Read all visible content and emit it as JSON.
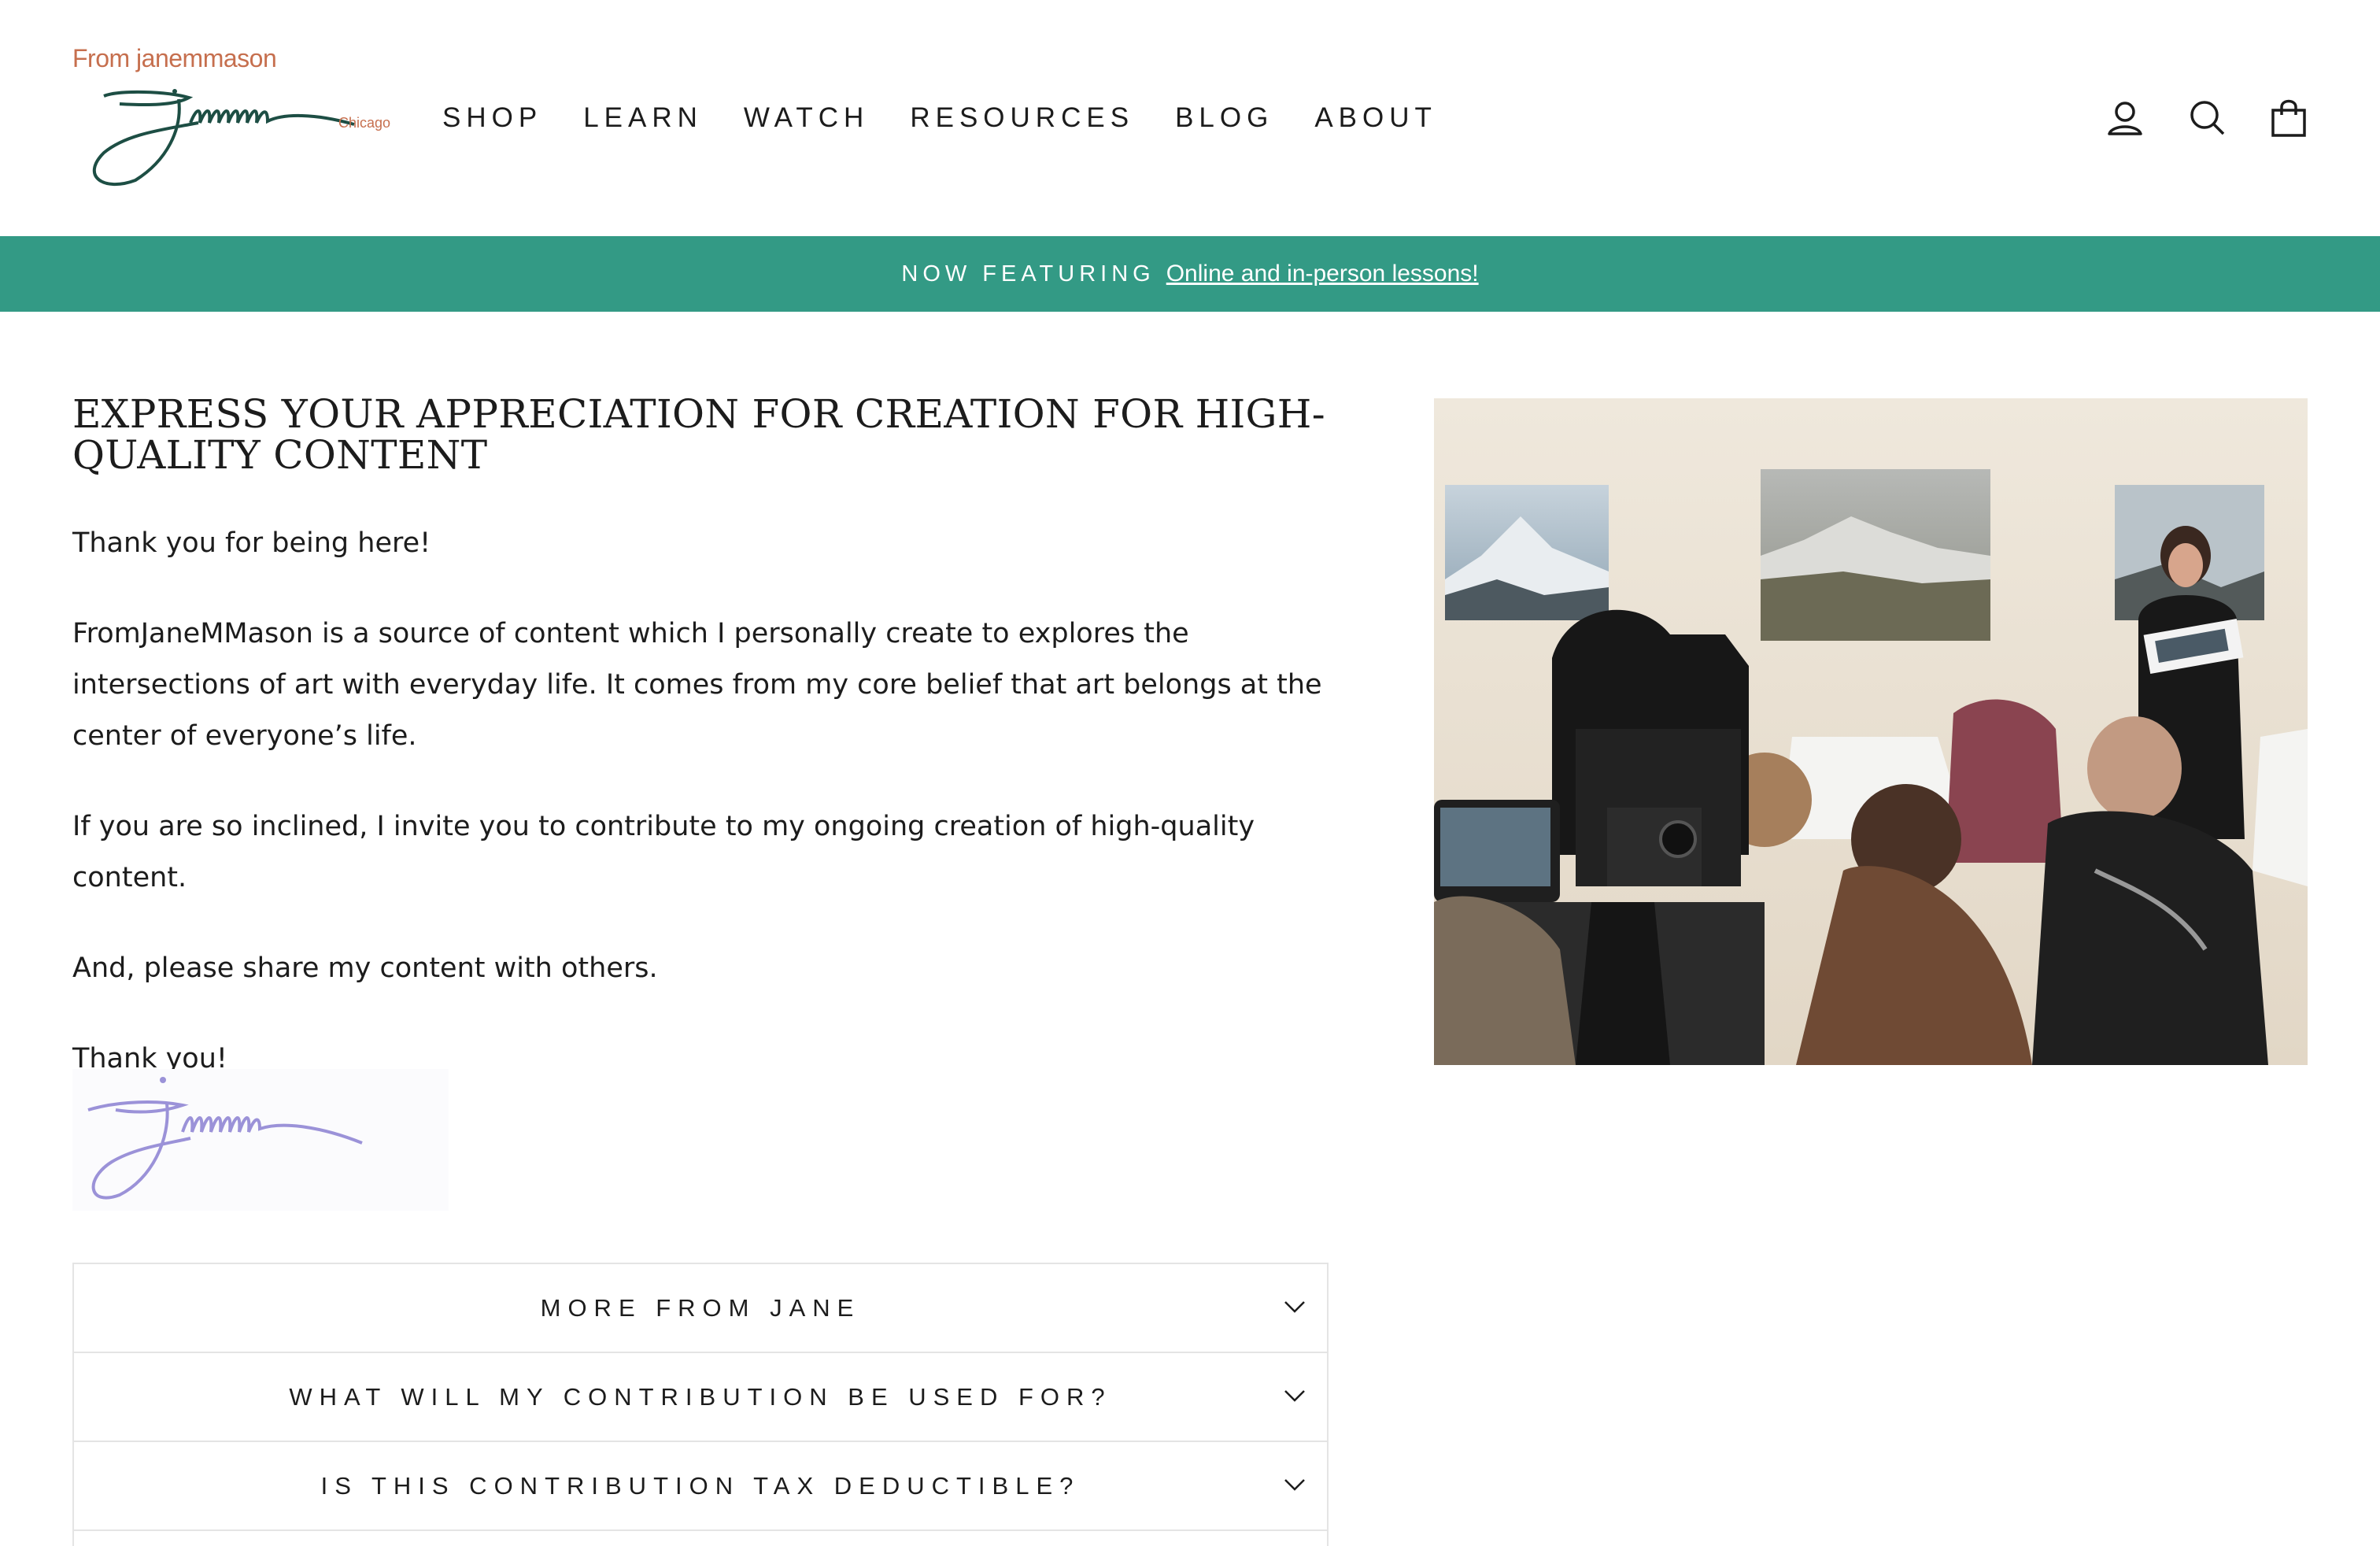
{
  "logo": {
    "brand_text": "From janemmason",
    "city_text": "Chicago",
    "signature_color": "#1d4e44",
    "text_color": "#c66f4e"
  },
  "nav": {
    "items": [
      {
        "label": "SHOP"
      },
      {
        "label": "LEARN"
      },
      {
        "label": "WATCH"
      },
      {
        "label": "RESOURCES"
      },
      {
        "label": "BLOG"
      },
      {
        "label": "ABOUT"
      }
    ]
  },
  "header_icons": [
    "account-icon",
    "search-icon",
    "cart-icon"
  ],
  "banner": {
    "label": "NOW FEATURING",
    "link_text": "Online and in-person lessons!",
    "color": "#339a85"
  },
  "main": {
    "heading": "EXPRESS YOUR APPRECIATION FOR CREATION FOR HIGH-QUALITY CONTENT",
    "paragraphs": [
      "Thank you for being here!",
      "FromJaneMMason is a source of content which I personally create to explores the intersections of art with everyday life. It comes from my core belief that art belongs at the center of everyone’s life.",
      "If you are so inclined, I invite you to contribute to my ongoing creation of high-quality content.",
      "And, please share my content with others.",
      "Thank you!"
    ],
    "signature_color": "#9b92d8"
  },
  "accordion": {
    "items": [
      {
        "label": "MORE FROM JANE"
      },
      {
        "label": "WHAT WILL MY CONTRIBUTION BE USED FOR?"
      },
      {
        "label": "IS THIS CONTRIBUTION TAX DEDUCTIBLE?"
      }
    ]
  }
}
